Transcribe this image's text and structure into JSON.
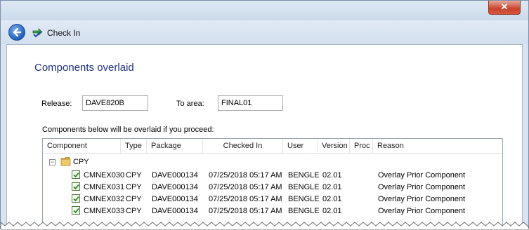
{
  "window": {
    "close_label": "✕"
  },
  "toolbar": {
    "checkin_label": "Check In"
  },
  "page": {
    "title": "Components overlaid",
    "release_label": "Release:",
    "release_value": "DAVE820B",
    "to_area_label": "To area:",
    "to_area_value": "FINAL01",
    "description": "Components below will be overlaid if you proceed:"
  },
  "grid": {
    "columns": [
      "Component",
      "Type",
      "Package",
      "Checked In",
      "User",
      "Version",
      "Proc",
      "Reason"
    ],
    "group": {
      "label": "CPY",
      "toggle": "−"
    },
    "rows": [
      {
        "component": "CMNEX030",
        "type": "CPY",
        "package": "DAVE000134",
        "checked_in": "07/25/2018  05:17 AM",
        "user": "BENGLE",
        "version": "02.01",
        "proc": "",
        "reason": "Overlay Prior Component",
        "checked": true
      },
      {
        "component": "CMNEX031",
        "type": "CPY",
        "package": "DAVE000134",
        "checked_in": "07/25/2018  05:17 AM",
        "user": "BENGLE",
        "version": "02.01",
        "proc": "",
        "reason": "Overlay Prior Component",
        "checked": true
      },
      {
        "component": "CMNEX032",
        "type": "CPY",
        "package": "DAVE000134",
        "checked_in": "07/25/2018  05:17 AM",
        "user": "BENGLE",
        "version": "02.01",
        "proc": "",
        "reason": "Overlay Prior Component",
        "checked": true
      },
      {
        "component": "CMNEX033",
        "type": "CPY",
        "package": "DAVE000134",
        "checked_in": "07/25/2018  05:17 AM",
        "user": "BENGLE",
        "version": "02.01",
        "proc": "",
        "reason": "Overlay Prior Component",
        "checked": true
      }
    ]
  },
  "icons": {
    "back": "back-arrow-icon",
    "checkin": "check-in-icon",
    "folder": "folder-icon",
    "checkbox": "checkbox-checked-icon"
  }
}
